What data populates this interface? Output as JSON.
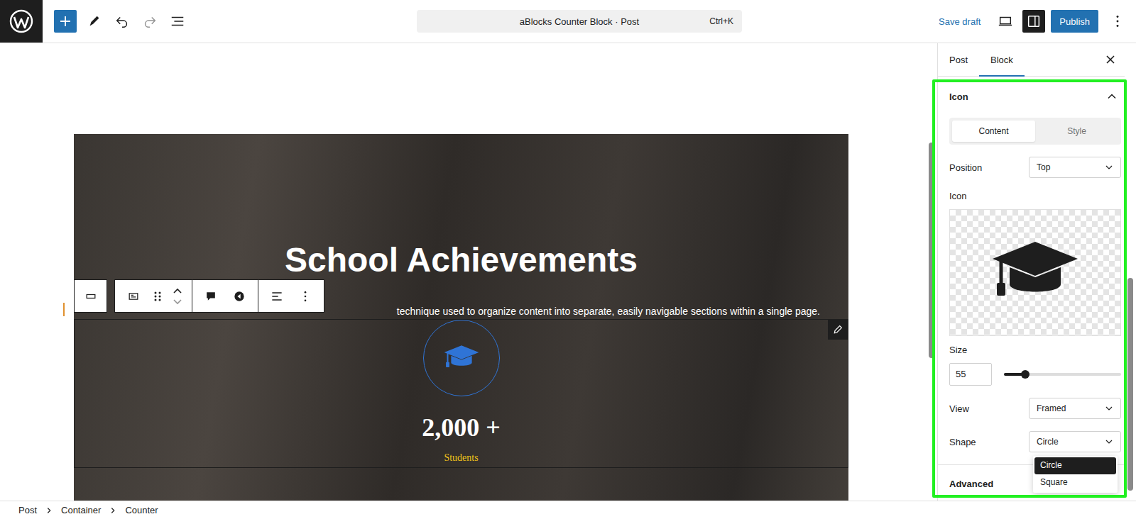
{
  "topbar": {
    "command_bar": "aBlocks Counter Block · Post",
    "shortcut": "Ctrl+K",
    "save_draft": "Save draft",
    "publish": "Publish",
    "sidebar_open": true,
    "undo_disabled": false,
    "redo_disabled": true
  },
  "canvas": {
    "heading": "School Achievements",
    "subtitle": "technique used to organize content into separate, easily navigable sections within a single page.",
    "counter": {
      "number": "2,000 +",
      "label": "Students",
      "selected": true
    }
  },
  "sidebar": {
    "tabs": [
      {
        "label": "Post",
        "selected": false
      },
      {
        "label": "Block",
        "selected": true
      }
    ],
    "panel": {
      "title": "Icon",
      "expanded": true,
      "segments": [
        {
          "label": "Content",
          "selected": true
        },
        {
          "label": "Style",
          "selected": false
        }
      ],
      "fields": [
        {
          "kind": "select",
          "label": "Position",
          "value": "Top",
          "open": false
        },
        {
          "kind": "icon",
          "label": "Icon"
        },
        {
          "kind": "slider",
          "label": "Size",
          "value": "55",
          "level": 0.18
        },
        {
          "kind": "select",
          "label": "View",
          "value": "Framed",
          "open": false
        },
        {
          "kind": "select",
          "label": "Shape",
          "value": "Circle",
          "open": true,
          "options": [
            {
              "label": "Circle",
              "selected": true
            },
            {
              "label": "Square",
              "selected": false
            }
          ]
        }
      ]
    },
    "advanced": {
      "title": "Advanced",
      "expanded": false
    }
  },
  "breadcrumb": [
    "Post",
    "Container",
    "Counter"
  ]
}
